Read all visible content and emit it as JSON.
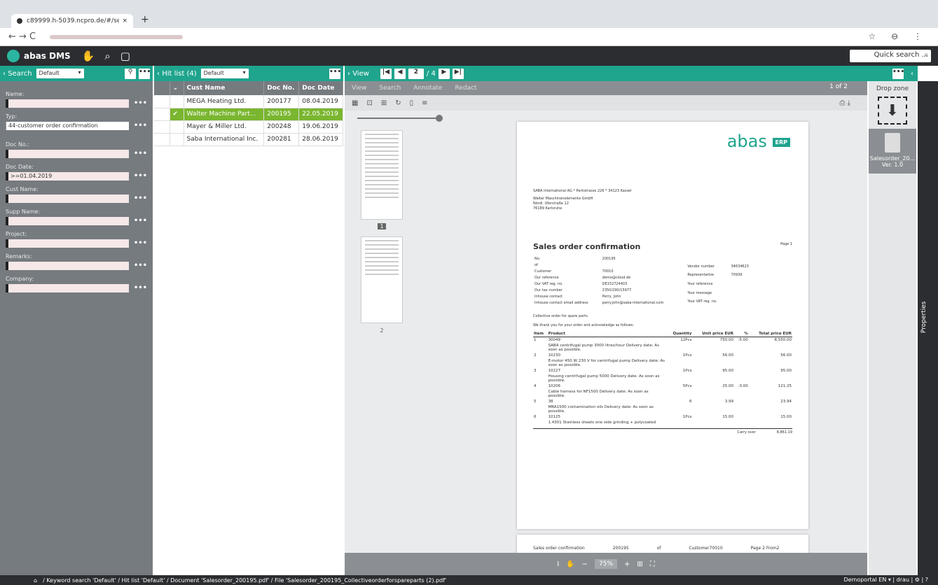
{
  "browser": {
    "tab_title": "c89999.h-5039.ncpro.de/#/se",
    "tab_close": "×",
    "new_tab": "+",
    "nav": "← → C",
    "actions": "☆ ⊖ ⋮"
  },
  "app": {
    "title": "abas DMS",
    "quick_search": "Quick search ...",
    "search_icon": "⌕"
  },
  "search": {
    "header": "Search",
    "preset": "Default",
    "more": "•••",
    "fields": [
      {
        "label": "Name:",
        "value": ""
      },
      {
        "label": "Typ:",
        "value": "44-customer order confirmation"
      },
      {
        "label": "Doc No.:",
        "value": ""
      },
      {
        "label": "Doc Date:",
        "value": ">=01.04.2019"
      },
      {
        "label": "Cust Name:",
        "value": ""
      },
      {
        "label": "Supp Name:",
        "value": ""
      },
      {
        "label": "Project:",
        "value": ""
      },
      {
        "label": "Remarks:",
        "value": ""
      },
      {
        "label": "Company:",
        "value": ""
      }
    ]
  },
  "hitlist": {
    "header": "Hit list (4)",
    "preset": "Default",
    "columns": [
      "Cust Name",
      "Doc No.",
      "Doc Date"
    ],
    "rows": [
      {
        "check": "",
        "name": "MEGA Heating Ltd.",
        "no": "200177",
        "date": "08.04.2019"
      },
      {
        "check": "✔",
        "name": "Walter Machine Part...",
        "no": "200195",
        "date": "22.05.2019"
      },
      {
        "check": "",
        "name": "Mayer & Miller Ltd.",
        "no": "200248",
        "date": "19.06.2019"
      },
      {
        "check": "",
        "name": "Saba International Inc.",
        "no": "200281",
        "date": "28.06.2019"
      }
    ]
  },
  "view": {
    "header": "View",
    "page": "2",
    "pages": "/ 4",
    "tools": [
      "View",
      "Search",
      "Annotate",
      "Redact"
    ],
    "page_of": "1 of 2",
    "zoom": "75%",
    "thumb_pages": [
      "1",
      "2"
    ]
  },
  "doc": {
    "sender": "SABA International AG * Parkstrasse 226 * 34123 Kassel",
    "recipient": [
      "Walter Maschinenelemente GmbH",
      "Nördl. Uferstraße 12",
      "76189 Karlsruhe"
    ],
    "title": "Sales order confirmation",
    "page": "Page 1",
    "meta": [
      [
        "No.",
        "200195"
      ],
      [
        "of",
        ""
      ],
      [
        "Customer",
        "70010"
      ],
      [
        "Our reference",
        "demo@cloud.de"
      ],
      [
        "Our VAT reg. no.",
        "DE152724403"
      ],
      [
        "Our tax number",
        "2350/290/15977"
      ],
      [
        "Inhouse contact",
        "Perry, John"
      ],
      [
        "Inhouse contact email address",
        "perry.john@saba-international.com"
      ]
    ],
    "meta2": [
      [
        "Vendor number",
        "34634623"
      ],
      [
        "Representative",
        "70939"
      ],
      [
        "Your reference",
        ""
      ],
      [
        "Your message",
        ""
      ],
      [
        "Your VAT reg. no.",
        ""
      ]
    ],
    "intro1": "Collective order for spare parts",
    "intro2": "We thank you for your order and acknowledge as follows:",
    "cols": [
      "Item",
      "Product",
      "Quantity",
      "Unit price EUR",
      "%",
      "Total price EUR"
    ],
    "items": [
      [
        "1",
        "30049",
        "12Pcs",
        "750.00",
        "-5.00",
        "8,550.00"
      ],
      [
        "",
        "SABA centrifugal pump 3000 litres/hour Delivery date: As soon as possible.",
        "",
        "",
        "",
        ""
      ],
      [
        "2",
        "10230",
        "1Pcs",
        "56.00",
        "",
        "56.00"
      ],
      [
        "",
        "E-motor 450 W 230 V for centrifugal pump Delivery date: As soon as possible.",
        "",
        "",
        "",
        ""
      ],
      [
        "3",
        "10227",
        "1Pcs",
        "95.00",
        "",
        "95.00"
      ],
      [
        "",
        "Housing centrifugal pump 5000 Delivery date: As soon as possible.",
        "",
        "",
        "",
        ""
      ],
      [
        "4",
        "10206",
        "5Pcs",
        "25.00",
        "-3.00",
        "121.25"
      ],
      [
        "",
        "Cable harness for NF1500 Delivery date: As soon as possible.",
        "",
        "",
        "",
        ""
      ],
      [
        "5",
        "38",
        "6",
        "3.99",
        "",
        "23.94"
      ],
      [
        "",
        "MRA1500 contamination oils Delivery date: As soon as possible.",
        "",
        "",
        "",
        ""
      ],
      [
        "6",
        "10125",
        "1Pcs",
        "15.00",
        "",
        "15.00"
      ],
      [
        "",
        "1.4301 Stainless sheets one side grinding + polycoated",
        "",
        "",
        "",
        ""
      ]
    ],
    "carry": "Carry over",
    "carry_val": "8,861.19",
    "page2": [
      "Sales order confirmation",
      "200195",
      "of",
      "Customer70010",
      "Page 2 From2"
    ]
  },
  "dropzone": {
    "label": "Drop zone",
    "arrow": "⬇",
    "file": "Salesorder_20...",
    "ver": "Ver. 1.0"
  },
  "properties": "Properties",
  "footer": {
    "path": "/ Keyword search 'Default'  / Hit list 'Default'  / Document 'Salesorder_200195.pdf'  / File 'Salesorder_200195_Collectiveorderforspareparts (2).pdf'",
    "right": "Demoportal EN ▾  |  drau  |  ⚙  |  ?"
  }
}
